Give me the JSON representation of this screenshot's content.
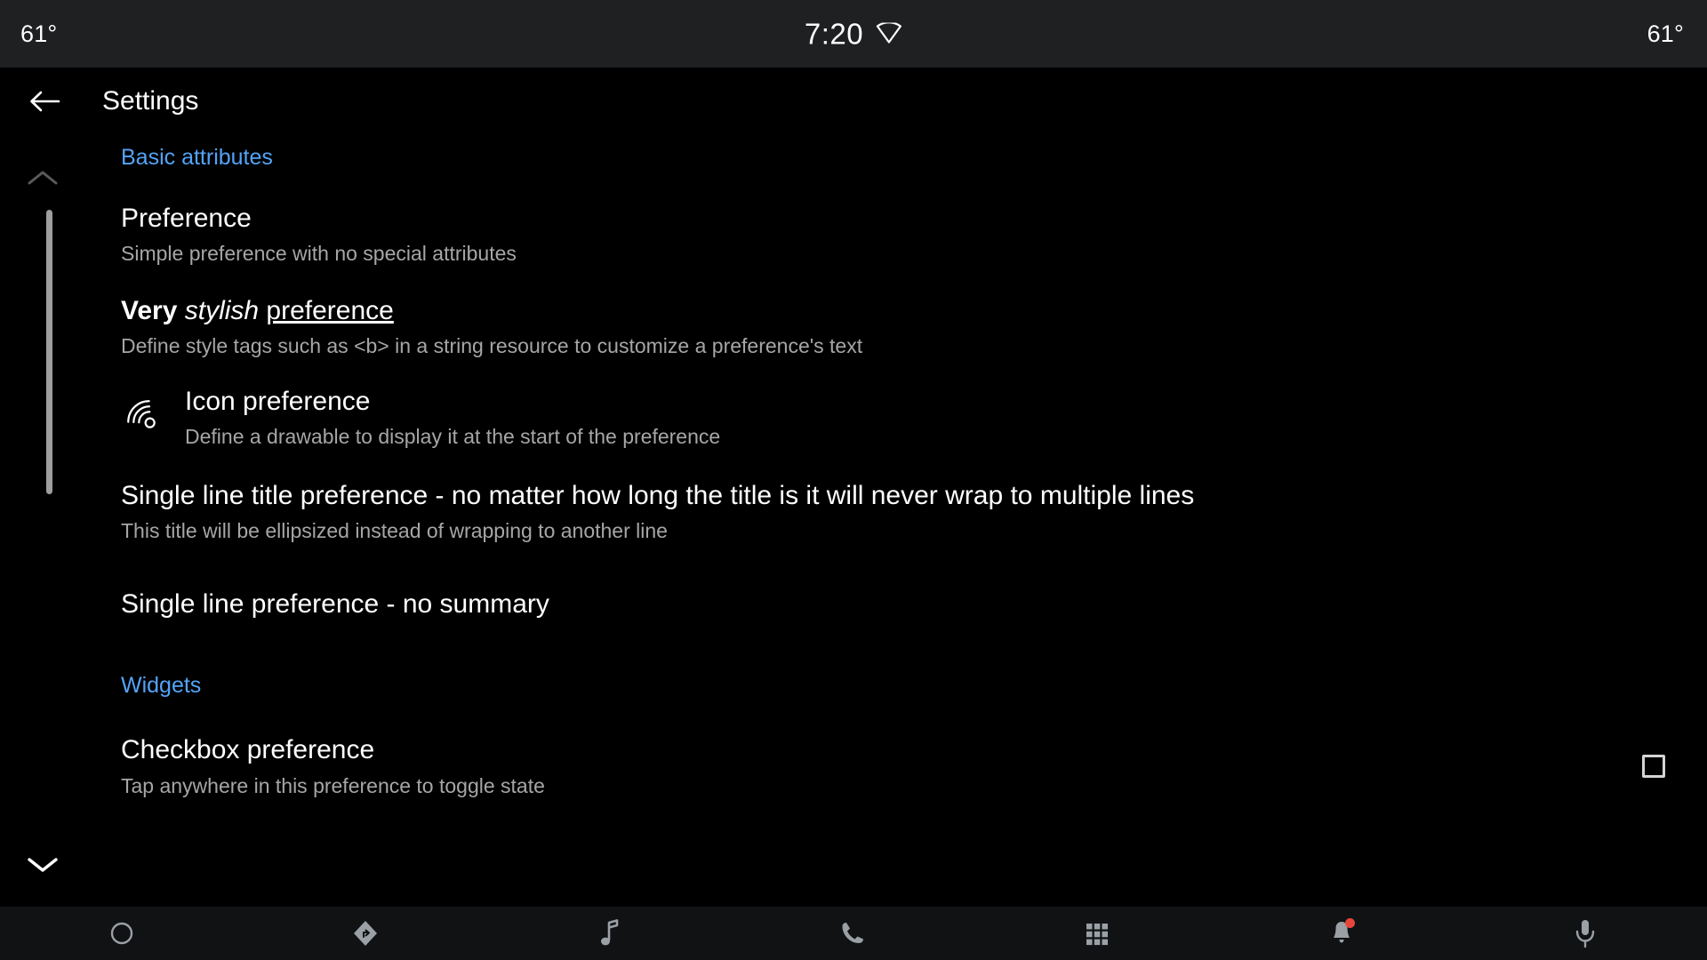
{
  "status_bar": {
    "temp_left": "61°",
    "temp_right": "61°",
    "clock": "7:20",
    "wifi_icon": "wifi-icon"
  },
  "app_bar": {
    "back_icon": "back-arrow-icon",
    "title": "Settings"
  },
  "rail": {
    "scroll_up_icon": "chevron-up-icon",
    "scroll_down_icon": "chevron-down-icon"
  },
  "sections": [
    {
      "header": "Basic attributes",
      "items": [
        {
          "title": "Preference",
          "summary": "Simple preference with no special attributes",
          "icon": null,
          "widget": null
        },
        {
          "title_rich": true,
          "title_parts": [
            {
              "text": "Very ",
              "style": "bold"
            },
            {
              "text": "stylish ",
              "style": "italic"
            },
            {
              "text": "preference",
              "style": "underline"
            }
          ],
          "title": "Very stylish preference",
          "summary": "Define style tags such as <b> in a string resource to customize a preference's text",
          "icon": null,
          "widget": null
        },
        {
          "title": "Icon preference",
          "summary": "Define a drawable to display it at the start of the preference",
          "icon": "wifi-tethering-icon",
          "widget": null
        },
        {
          "title": "Single line title preference - no matter how long the title is it will never wrap to multiple lines",
          "summary": "This title will be ellipsized instead of wrapping to another line",
          "icon": null,
          "widget": null
        },
        {
          "title": "Single line preference - no summary",
          "summary": null,
          "icon": null,
          "widget": null
        }
      ]
    },
    {
      "header": "Widgets",
      "items": [
        {
          "title": "Checkbox preference",
          "summary": "Tap anywhere in this preference to toggle state",
          "icon": null,
          "widget": "checkbox",
          "checked": false
        }
      ]
    }
  ],
  "nav_bar": {
    "items": [
      {
        "name": "home-circle-icon",
        "label": "Home"
      },
      {
        "name": "navigation-icon",
        "label": "Navigation"
      },
      {
        "name": "music-note-icon",
        "label": "Media"
      },
      {
        "name": "phone-icon",
        "label": "Phone"
      },
      {
        "name": "apps-grid-icon",
        "label": "Apps"
      },
      {
        "name": "bell-notification-icon",
        "label": "Notifications",
        "badge": true
      },
      {
        "name": "microphone-icon",
        "label": "Assistant"
      }
    ]
  },
  "colors": {
    "background": "#000000",
    "status_bar_bg": "#1e2021",
    "nav_bar_bg": "#101214",
    "accent_blue": "#54a3f7",
    "primary_text": "#ffffff",
    "secondary_text": "#a6a6a6",
    "badge_red": "#e8453c",
    "scrollbar": "#9e9e9e"
  }
}
